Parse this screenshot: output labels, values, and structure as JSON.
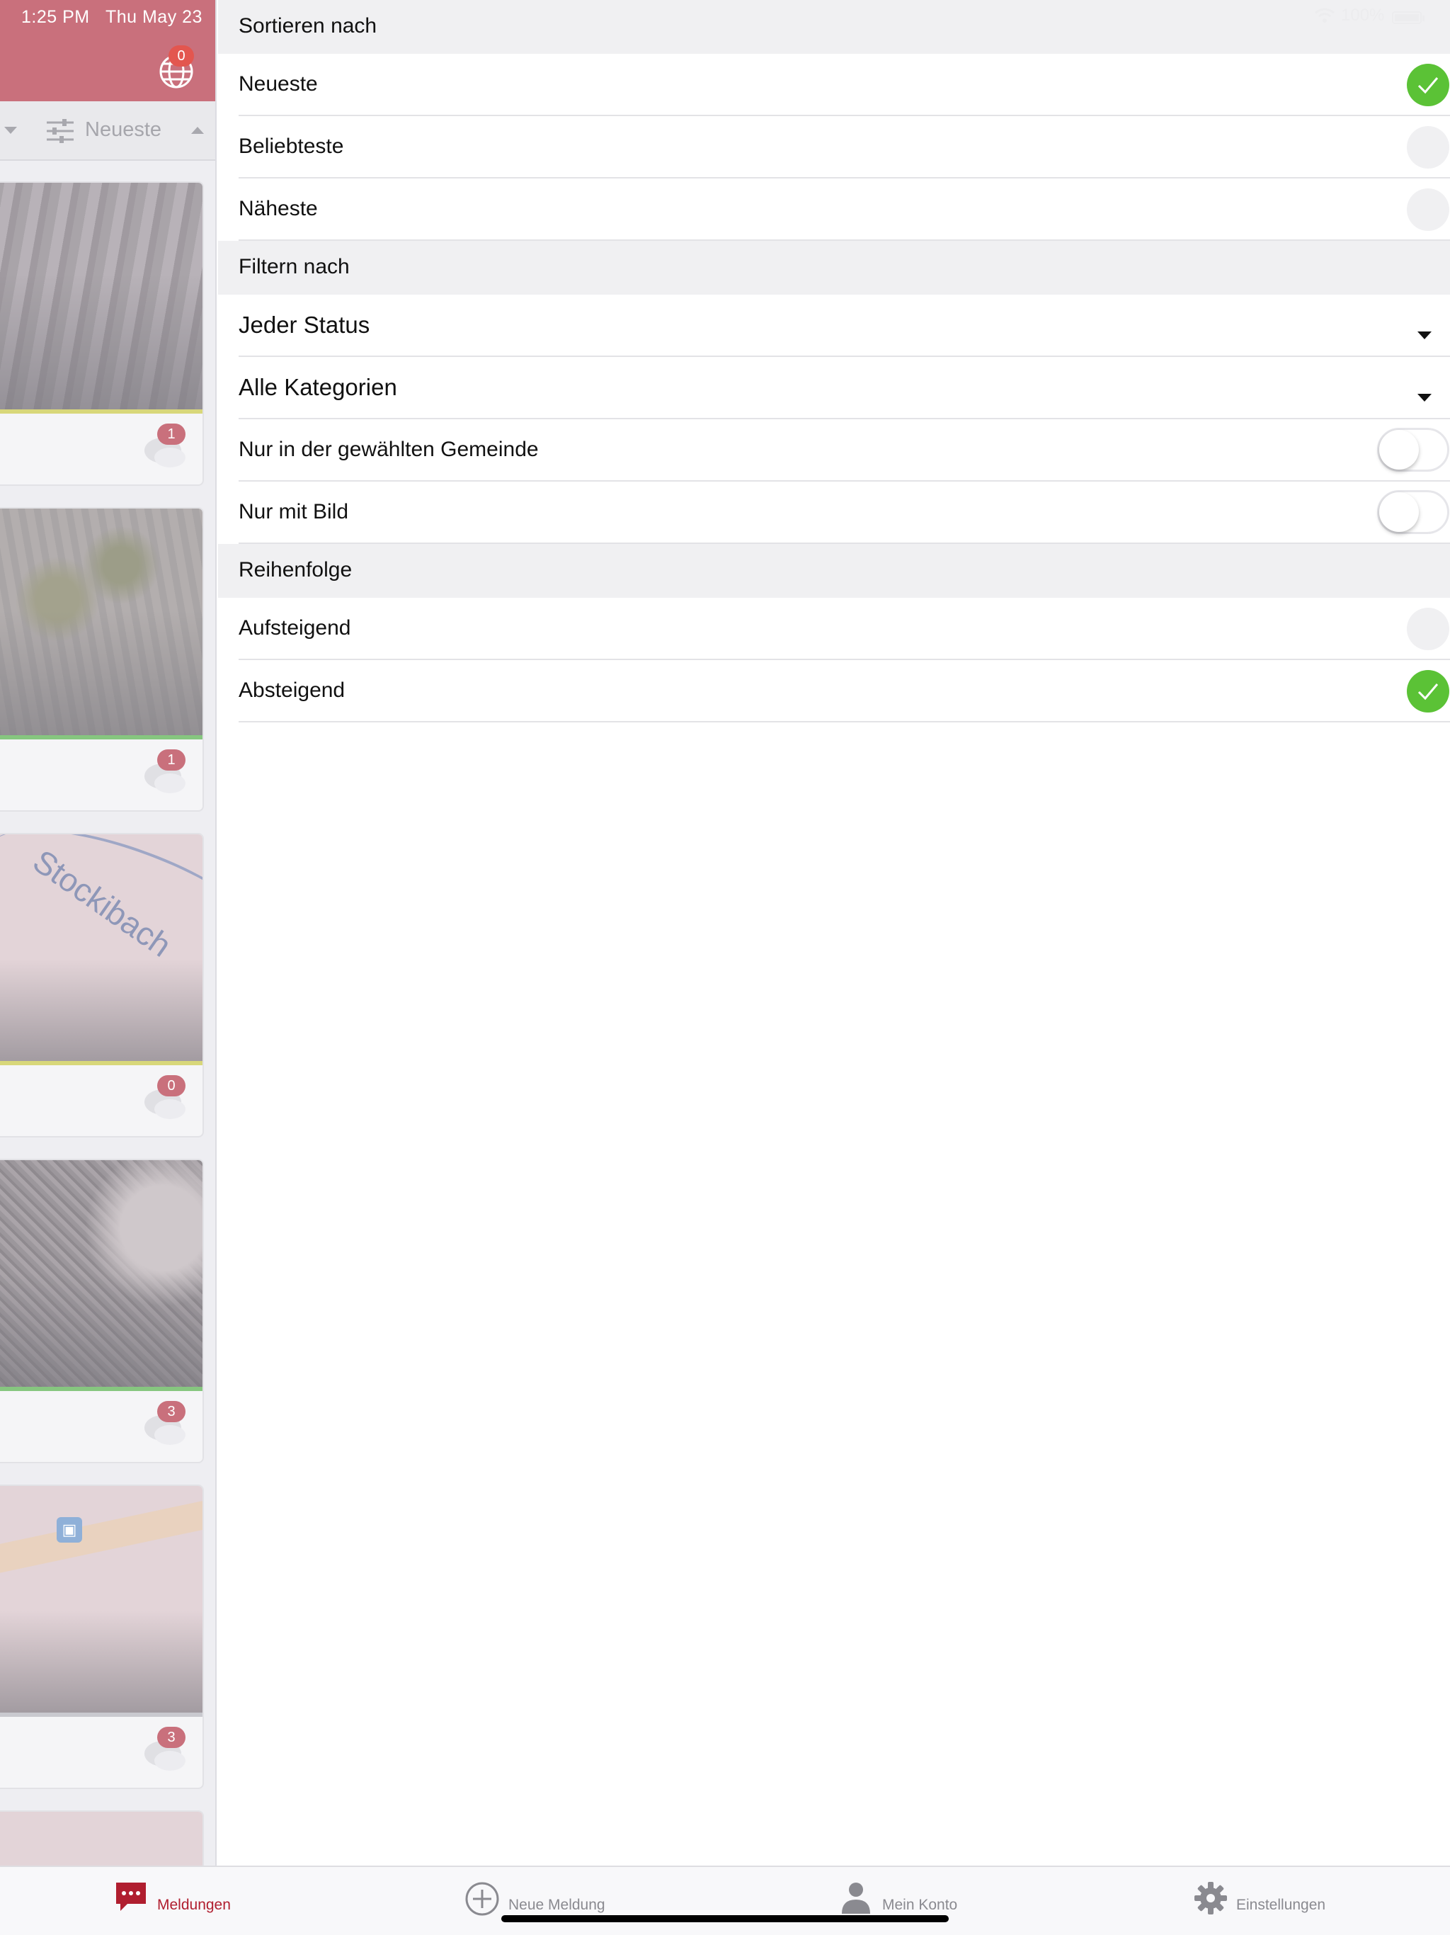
{
  "status_bar": {
    "time": "1:25 PM",
    "date": "Thu May 23",
    "battery": "100%"
  },
  "header": {
    "notification_count": "0"
  },
  "left_list": {
    "sort_label": "Neueste",
    "cards": [
      {
        "comments": "1",
        "status_color": "#d8d77a"
      },
      {
        "comments": "1",
        "status_color": "#86c67f"
      },
      {
        "comments": "0",
        "status_color": "#d8d77a",
        "map_label": "Stockibach"
      },
      {
        "comments": "3",
        "status_color": "#86c67f"
      },
      {
        "comments": "3",
        "status_color": "#c9c9cf"
      }
    ]
  },
  "sheet": {
    "sort_section": {
      "title": "Sortieren nach",
      "options": [
        {
          "label": "Neueste",
          "selected": true
        },
        {
          "label": "Beliebteste",
          "selected": false
        },
        {
          "label": "Näheste",
          "selected": false
        }
      ]
    },
    "filter_section": {
      "title": "Filtern nach",
      "dropdowns": [
        {
          "label": "Jeder Status"
        },
        {
          "label": "Alle Kategorien"
        }
      ],
      "toggles": [
        {
          "label": "Nur in der gewählten Gemeinde",
          "on": false
        },
        {
          "label": "Nur mit Bild",
          "on": false
        }
      ]
    },
    "order_section": {
      "title": "Reihenfolge",
      "options": [
        {
          "label": "Aufsteigend",
          "selected": false
        },
        {
          "label": "Absteigend",
          "selected": true
        }
      ]
    }
  },
  "tabbar": {
    "tabs": [
      {
        "label": "Meldungen",
        "icon": "chat-bubble-icon",
        "active": true
      },
      {
        "label": "Neue Meldung",
        "icon": "plus-circle-icon",
        "active": false
      },
      {
        "label": "Mein Konto",
        "icon": "person-icon",
        "active": false
      },
      {
        "label": "Einstellungen",
        "icon": "gear-icon",
        "active": false
      }
    ]
  },
  "colors": {
    "accent_red": "#b01e2f",
    "header_red": "#c9707c",
    "check_green": "#5bc236"
  }
}
